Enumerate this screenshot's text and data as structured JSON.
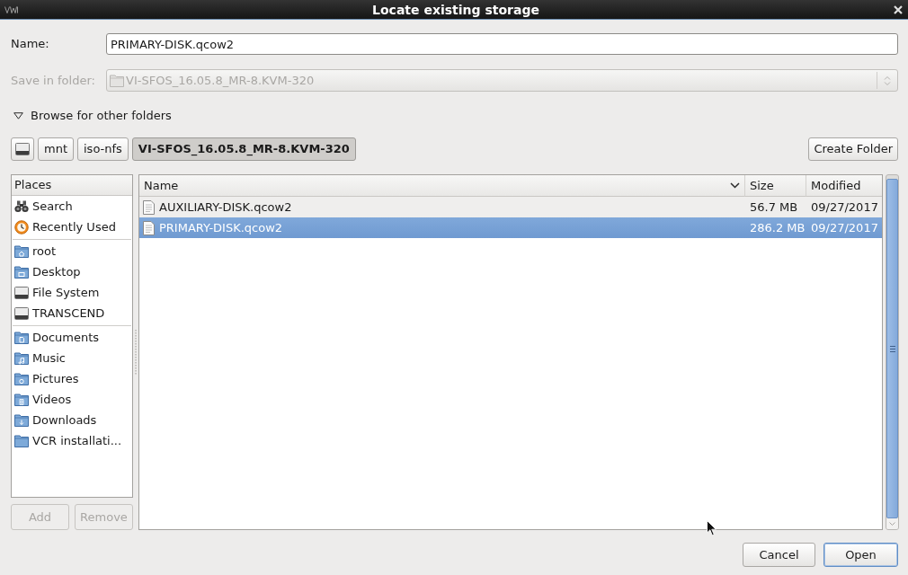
{
  "window": {
    "title": "Locate existing storage"
  },
  "name_field": {
    "label": "Name:",
    "value": "PRIMARY-DISK.qcow2"
  },
  "save_in_folder": {
    "label": "Save in folder:",
    "value": "VI-SFOS_16.05.8_MR-8.KVM-320",
    "disabled": true
  },
  "browse_expander": {
    "label": "Browse for other folders",
    "expanded": true
  },
  "path_bar": [
    {
      "kind": "drive",
      "selected": false
    },
    {
      "kind": "folder",
      "label": "mnt",
      "selected": false
    },
    {
      "kind": "folder",
      "label": "iso-nfs",
      "selected": false
    },
    {
      "kind": "folder",
      "label": "VI-SFOS_16.05.8_MR-8.KVM-320",
      "selected": true
    }
  ],
  "create_folder_button": "Create Folder",
  "places": {
    "header": "Places",
    "groups": [
      [
        {
          "kind": "search",
          "label": "Search",
          "selected": false
        },
        {
          "kind": "recent",
          "label": "Recently Used",
          "selected": false
        }
      ],
      [
        {
          "kind": "home",
          "label": "root",
          "selected": false
        },
        {
          "kind": "desktop",
          "label": "Desktop",
          "selected": false
        },
        {
          "kind": "drive",
          "label": "File System",
          "selected": false
        },
        {
          "kind": "drive",
          "label": "TRANSCEND",
          "selected": false
        }
      ],
      [
        {
          "kind": "documents",
          "label": "Documents",
          "selected": false
        },
        {
          "kind": "music",
          "label": "Music",
          "selected": false
        },
        {
          "kind": "pictures",
          "label": "Pictures",
          "selected": false
        },
        {
          "kind": "videos",
          "label": "Videos",
          "selected": false
        },
        {
          "kind": "downloads",
          "label": "Downloads",
          "selected": false
        },
        {
          "kind": "folder",
          "label": "VCR installati...",
          "selected": false
        }
      ]
    ]
  },
  "place_buttons": [
    {
      "label": "Add",
      "disabled": true
    },
    {
      "label": "Remove",
      "disabled": true
    }
  ],
  "file_list": {
    "columns": [
      {
        "label": "Name",
        "sorted": true
      },
      {
        "label": "Size",
        "sorted": false
      },
      {
        "label": "Modified",
        "sorted": false
      }
    ],
    "rows": [
      {
        "name": "AUXILIARY-DISK.qcow2",
        "size": "56.7 MB",
        "modified": "09/27/2017",
        "selected": false
      },
      {
        "name": "PRIMARY-DISK.qcow2",
        "size": "286.2 MB",
        "modified": "09/27/2017",
        "selected": true
      }
    ]
  },
  "buttons": [
    {
      "label": "Cancel",
      "focused": false
    },
    {
      "label": "Open",
      "focused": true
    }
  ]
}
